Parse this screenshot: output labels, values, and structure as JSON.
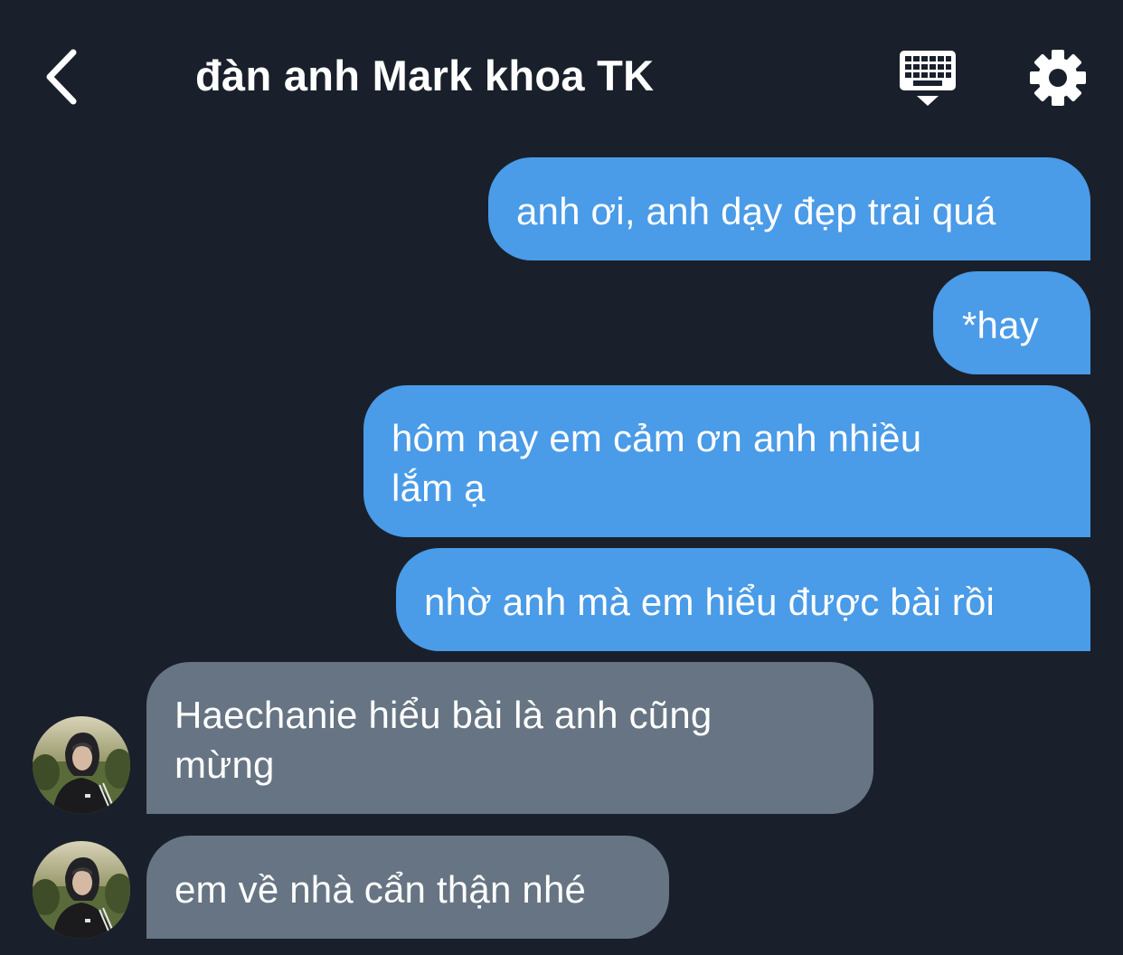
{
  "header": {
    "title": "đàn anh Mark khoa TK",
    "back_icon": "chevron-left-icon",
    "keyboard_icon": "keyboard-hide-icon",
    "settings_icon": "gear-icon"
  },
  "colors": {
    "background": "#19202b",
    "outgoing_bubble": "#4a9be8",
    "incoming_bubble": "#667483",
    "text": "#ffffff"
  },
  "messages": [
    {
      "direction": "outgoing",
      "text": "anh ơi, anh dạy đẹp trai quá"
    },
    {
      "direction": "outgoing",
      "text": "*hay"
    },
    {
      "direction": "outgoing",
      "line1": "hôm nay em cảm ơn anh nhiều",
      "line2": "lắm ạ"
    },
    {
      "direction": "outgoing",
      "text": "nhờ anh mà em hiểu được bài rồi"
    },
    {
      "direction": "incoming",
      "line1": "Haechanie hiểu bài là anh cũng",
      "line2": "mừng"
    },
    {
      "direction": "incoming",
      "text": "em về nhà cẩn thận nhé"
    }
  ]
}
